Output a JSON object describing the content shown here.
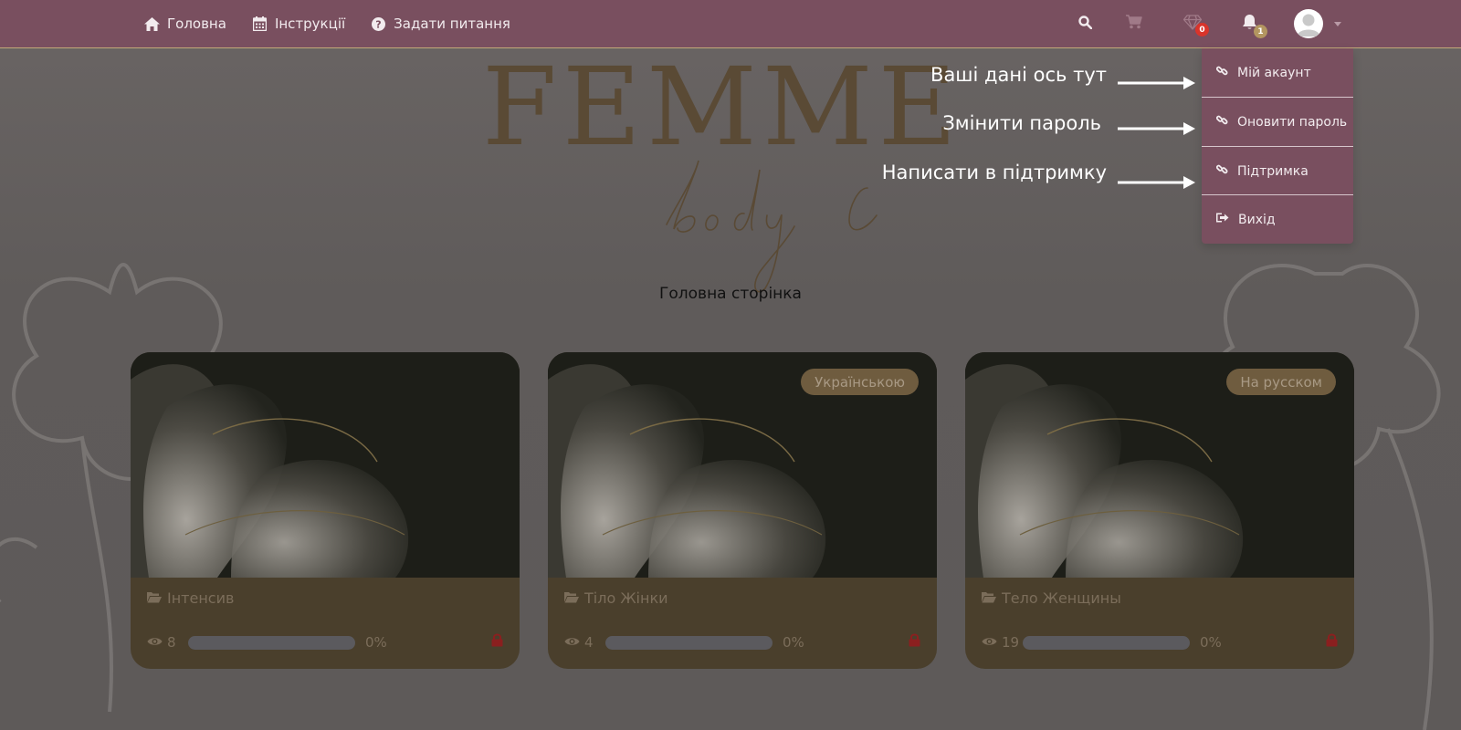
{
  "nav": {
    "home": "Головна",
    "instructions": "Інструкції",
    "ask": "Задати питання"
  },
  "badges": {
    "gems": "0",
    "notifications": "1"
  },
  "logo": {
    "main": "FEMME",
    "script": "body l"
  },
  "page_title": "Головна сторінка",
  "cards": [
    {
      "title": "Інтенсив",
      "tag": "",
      "views": "8",
      "progress": "0%",
      "progress_value": 0
    },
    {
      "title": "Тіло Жінки",
      "tag": "Українською",
      "views": "4",
      "progress": "0%",
      "progress_value": 0
    },
    {
      "title": "Тело Женщины",
      "tag": "На русском",
      "views": "19",
      "progress": "0%",
      "progress_value": 0
    }
  ],
  "dropdown": {
    "account": "Мій акаунт",
    "password": "Оновити пароль",
    "support": "Підтримка",
    "logout": "Вихід"
  },
  "annotations": {
    "account": "Ваші дані ось тут",
    "password": "Змінити пароль",
    "support": "Написати в підтримку"
  },
  "colors": {
    "navbar": "#794f5f",
    "accent": "#c2a978",
    "card_body": "#4a3f2c",
    "gem_badge": "#d9342b",
    "notif_badge": "#b39660"
  }
}
